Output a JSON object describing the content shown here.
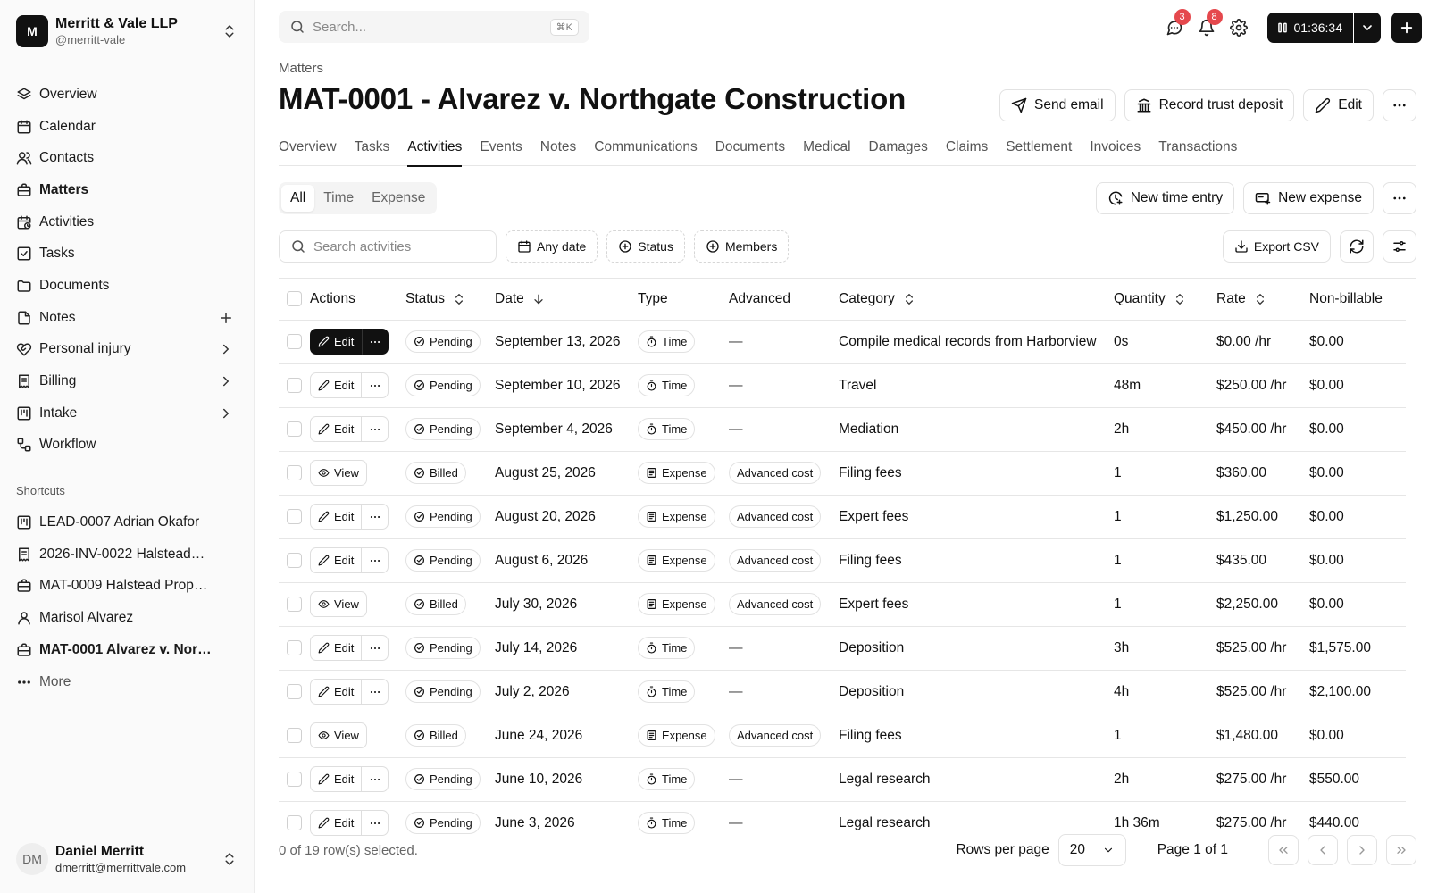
{
  "org": {
    "initial": "M",
    "name": "Merritt & Vale LLP",
    "handle": "@merritt-vale"
  },
  "nav": [
    {
      "label": "Overview",
      "icon": "layers-icon",
      "trail": ""
    },
    {
      "label": "Calendar",
      "icon": "calendar-icon",
      "trail": ""
    },
    {
      "label": "Contacts",
      "icon": "users-icon",
      "trail": ""
    },
    {
      "label": "Matters",
      "icon": "briefcase-icon",
      "trail": "",
      "active": true
    },
    {
      "label": "Activities",
      "icon": "clock-calendar-icon",
      "trail": ""
    },
    {
      "label": "Tasks",
      "icon": "checkbox-icon",
      "trail": ""
    },
    {
      "label": "Documents",
      "icon": "folder-icon",
      "trail": ""
    },
    {
      "label": "Notes",
      "icon": "file-icon",
      "trail": "plus"
    },
    {
      "label": "Personal injury",
      "icon": "heart-handshake-icon",
      "trail": "chevron"
    },
    {
      "label": "Billing",
      "icon": "receipt-icon",
      "trail": "chevron"
    },
    {
      "label": "Intake",
      "icon": "kanban-icon",
      "trail": "chevron"
    },
    {
      "label": "Workflow",
      "icon": "workflow-icon",
      "trail": ""
    }
  ],
  "shortcuts_label": "Shortcuts",
  "shortcuts": [
    {
      "label": "LEAD-0007 Adrian Okafor",
      "icon": "kanban-icon"
    },
    {
      "label": "2026-INV-0022 Halstead…",
      "icon": "receipt-icon"
    },
    {
      "label": "MAT-0009 Halstead Prop…",
      "icon": "briefcase-icon"
    },
    {
      "label": "Marisol Alvarez",
      "icon": "user-icon"
    },
    {
      "label": "MAT-0001 Alvarez v. Nor…",
      "icon": "briefcase-icon",
      "active": true
    },
    {
      "label": "More",
      "icon": "ellipsis-icon"
    }
  ],
  "user": {
    "initials": "DM",
    "name": "Daniel Merritt",
    "email": "dmerritt@merrittvale.com"
  },
  "search": {
    "placeholder": "Search...",
    "shortcut": "⌘K"
  },
  "top": {
    "messages_count": "3",
    "notifications_count": "8",
    "timer": "01:36:34"
  },
  "breadcrumb": "Matters",
  "title": "MAT-0001 - Alvarez v. Northgate Construction",
  "title_actions": {
    "send_email": "Send email",
    "trust_deposit": "Record trust deposit",
    "edit": "Edit"
  },
  "tabs": [
    "Overview",
    "Tasks",
    "Activities",
    "Events",
    "Notes",
    "Communications",
    "Documents",
    "Medical",
    "Damages",
    "Claims",
    "Settlement",
    "Invoices",
    "Transactions"
  ],
  "active_tab": "Activities",
  "segments": [
    "All",
    "Time",
    "Expense"
  ],
  "segment_actions": {
    "new_time": "New time entry",
    "new_expense": "New expense"
  },
  "filters": {
    "search_placeholder": "Search activities",
    "date": "Any date",
    "status": "Status",
    "members": "Members",
    "export": "Export CSV"
  },
  "columns": [
    "Actions",
    "Status",
    "Date",
    "Type",
    "Advanced",
    "Category",
    "Quantity",
    "Rate",
    "Non-billable"
  ],
  "rows": [
    {
      "action": "Edit",
      "dark": true,
      "status": "Pending",
      "date": "September 13, 2026",
      "type": "Time",
      "advanced": "—",
      "category": "Compile medical records from Harborview",
      "quantity": "0s",
      "rate": "$0.00 /hr",
      "nonbillable": "$0.00"
    },
    {
      "action": "Edit",
      "status": "Pending",
      "date": "September 10, 2026",
      "type": "Time",
      "advanced": "—",
      "category": "Travel",
      "quantity": "48m",
      "rate": "$250.00 /hr",
      "nonbillable": "$0.00"
    },
    {
      "action": "Edit",
      "status": "Pending",
      "date": "September 4, 2026",
      "type": "Time",
      "advanced": "—",
      "category": "Mediation",
      "quantity": "2h",
      "rate": "$450.00 /hr",
      "nonbillable": "$0.00"
    },
    {
      "action": "View",
      "status": "Billed",
      "date": "August 25, 2026",
      "type": "Expense",
      "advanced": "Advanced cost",
      "category": "Filing fees",
      "quantity": "1",
      "rate": "$360.00",
      "nonbillable": "$0.00"
    },
    {
      "action": "Edit",
      "status": "Pending",
      "date": "August 20, 2026",
      "type": "Expense",
      "advanced": "Advanced cost",
      "category": "Expert fees",
      "quantity": "1",
      "rate": "$1,250.00",
      "nonbillable": "$0.00"
    },
    {
      "action": "Edit",
      "status": "Pending",
      "date": "August 6, 2026",
      "type": "Expense",
      "advanced": "Advanced cost",
      "category": "Filing fees",
      "quantity": "1",
      "rate": "$435.00",
      "nonbillable": "$0.00"
    },
    {
      "action": "View",
      "status": "Billed",
      "date": "July 30, 2026",
      "type": "Expense",
      "advanced": "Advanced cost",
      "category": "Expert fees",
      "quantity": "1",
      "rate": "$2,250.00",
      "nonbillable": "$0.00"
    },
    {
      "action": "Edit",
      "status": "Pending",
      "date": "July 14, 2026",
      "type": "Time",
      "advanced": "—",
      "category": "Deposition",
      "quantity": "3h",
      "rate": "$525.00 /hr",
      "nonbillable": "$1,575.00"
    },
    {
      "action": "Edit",
      "status": "Pending",
      "date": "July 2, 2026",
      "type": "Time",
      "advanced": "—",
      "category": "Deposition",
      "quantity": "4h",
      "rate": "$525.00 /hr",
      "nonbillable": "$2,100.00"
    },
    {
      "action": "View",
      "status": "Billed",
      "date": "June 24, 2026",
      "type": "Expense",
      "advanced": "Advanced cost",
      "category": "Filing fees",
      "quantity": "1",
      "rate": "$1,480.00",
      "nonbillable": "$0.00"
    },
    {
      "action": "Edit",
      "status": "Pending",
      "date": "June 10, 2026",
      "type": "Time",
      "advanced": "—",
      "category": "Legal research",
      "quantity": "2h",
      "rate": "$275.00 /hr",
      "nonbillable": "$550.00"
    },
    {
      "action": "Edit",
      "status": "Pending",
      "date": "June 3, 2026",
      "type": "Time",
      "advanced": "—",
      "category": "Legal research",
      "quantity": "1h 36m",
      "rate": "$275.00 /hr",
      "nonbillable": "$440.00"
    }
  ],
  "footer": {
    "selected": "0 of 19 row(s) selected.",
    "rows_per_page_label": "Rows per page",
    "rows_per_page": "20",
    "page_info": "Page 1 of 1"
  }
}
